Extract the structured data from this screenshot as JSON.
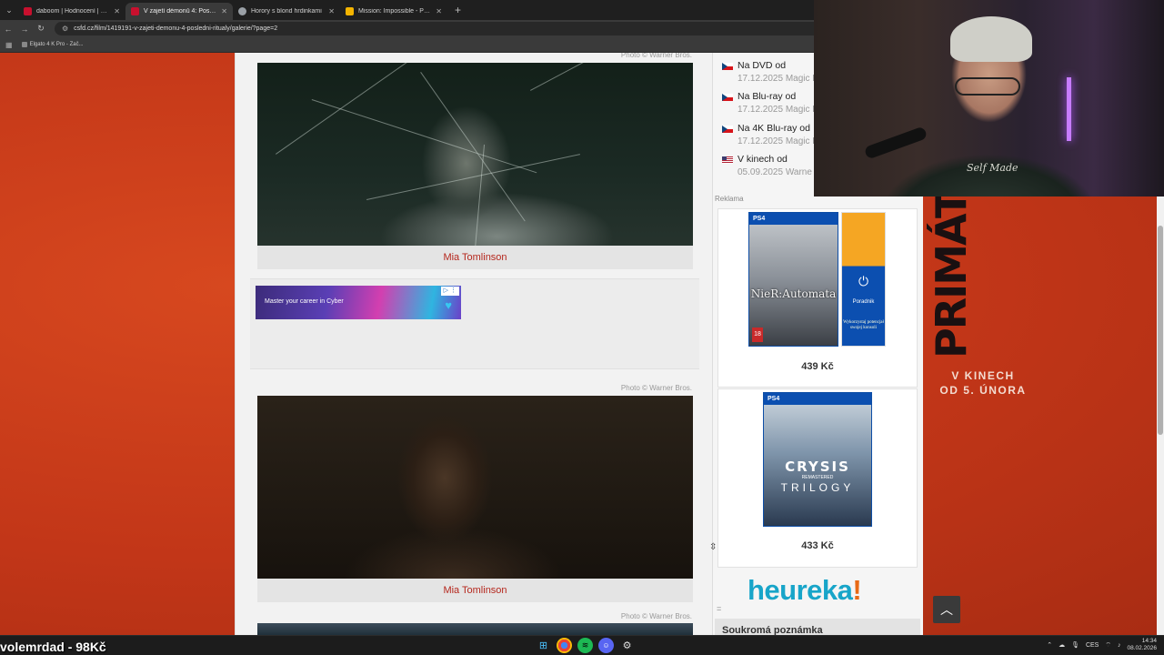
{
  "browser": {
    "tabs": [
      {
        "title": "daboom | Hodnocení | ČSFD.cz",
        "favicon_color": "#c8102e",
        "active": false
      },
      {
        "title": "V zajetí démonů 4: Poslední rit...",
        "favicon_color": "#c8102e",
        "active": true
      },
      {
        "title": "Horory s blond hrdinkami",
        "favicon_color": "#9aa0a6",
        "active": false
      },
      {
        "title": "Mission: Impossible - Posledni",
        "favicon_color": "#f4b400",
        "active": false
      }
    ],
    "url": "csfd.cz/film/1419191-v-zajeti-demonu-4-posledni-ritualy/galerie/?page=2",
    "bookmarks": [
      {
        "label": "Elgato 4 K Pro - Zač..."
      }
    ]
  },
  "gallery": {
    "photo_credit": "Photo © Warner Bros.",
    "items": [
      {
        "caption": "Mia Tomlinson"
      },
      {
        "caption": "Mia Tomlinson"
      }
    ],
    "ad": {
      "text": "Master your career in Cyber",
      "badge": "▷ ⋮"
    }
  },
  "sidebar": {
    "releases": [
      {
        "flag": "cz",
        "label": "Na DVD od",
        "date": "17.12.2025 Magic B"
      },
      {
        "flag": "cz",
        "label": "Na Blu-ray od",
        "date": "17.12.2025 Magic B"
      },
      {
        "flag": "cz",
        "label": "Na 4K Blu-ray od",
        "date": "17.12.2025 Magic B"
      },
      {
        "flag": "us",
        "label": "V kinech od",
        "date": "05.09.2025 Warne"
      }
    ],
    "ad_label": "Reklama",
    "products": [
      {
        "platform": "PS4",
        "title": "NieR:Automata",
        "price": "439 Kč",
        "rating": "18",
        "extra": "Poradnik",
        "extra_sub": "Wykorzystaj potencjał swojej konsoli"
      },
      {
        "platform": "PS4",
        "title": "CRYSIS",
        "subtitle": "REMASTERED",
        "subtitle2": "TRILOGY",
        "price": "433 Kč"
      }
    ],
    "heureka": {
      "main": "heureka",
      "accent": "!"
    },
    "note_title": "Soukromá poznámka"
  },
  "poster": {
    "title": "PRIMÁT",
    "subtitle_line1": "V KINECH",
    "subtitle_line2": "OD 5. ÚNORA"
  },
  "webcam": {
    "shirt_text": "Self Made"
  },
  "overlay": {
    "text": "volemrdad - 98Kč"
  },
  "taskbar": {
    "language": "CES",
    "time": "14:34",
    "date": "08.02.2026"
  },
  "colors": {
    "link_red": "#b5271d",
    "page_bg": "#c73a1c",
    "heureka_blue": "#18a5c9",
    "heureka_orange": "#e86a15"
  }
}
